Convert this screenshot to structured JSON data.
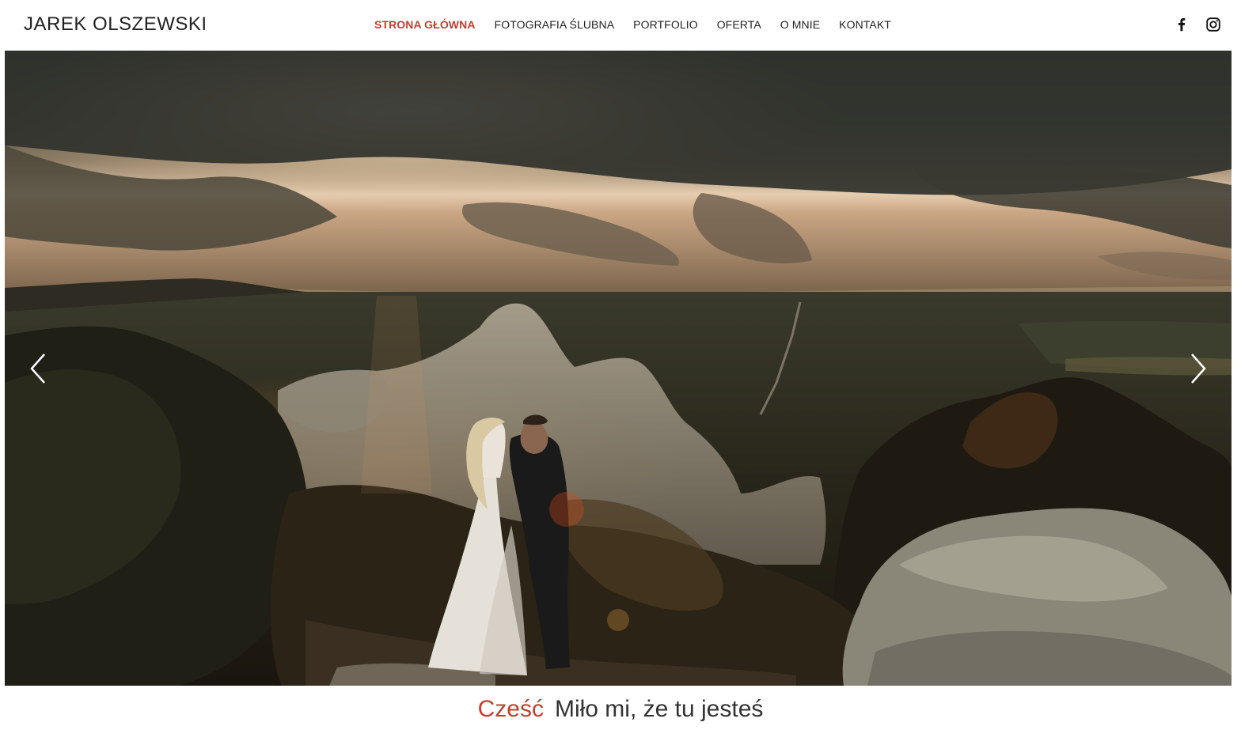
{
  "header": {
    "site_title": "JAREK OLSZEWSKI",
    "nav": [
      {
        "label": "STRONA GŁÓWNA",
        "active": true
      },
      {
        "label": "FOTOGRAFIA ŚLUBNA",
        "active": false
      },
      {
        "label": "PORTFOLIO",
        "active": false
      },
      {
        "label": "OFERTA",
        "active": false
      },
      {
        "label": "O MNIE",
        "active": false
      },
      {
        "label": "KONTAKT",
        "active": false
      }
    ],
    "social": [
      "facebook-icon",
      "instagram-icon"
    ]
  },
  "hero": {
    "prev_icon": "chevron-left-icon",
    "next_icon": "chevron-right-icon"
  },
  "greeting": {
    "accent": "Cześć",
    "text": "Miło mi, że tu jesteś"
  },
  "colors": {
    "accent": "#c53d2e",
    "text": "#222222"
  }
}
